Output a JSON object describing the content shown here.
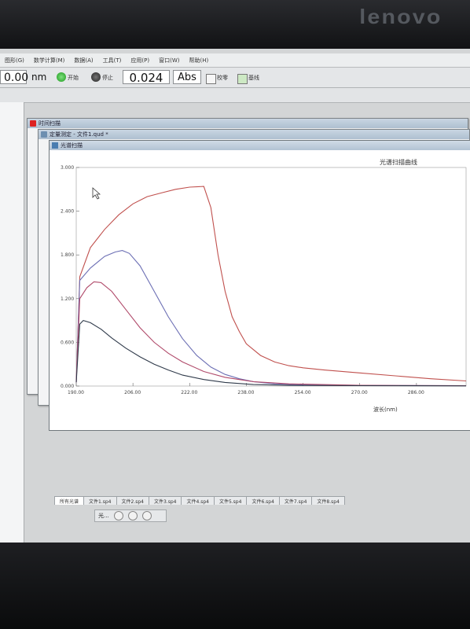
{
  "device": {
    "brand": "lenovo"
  },
  "menu": [
    "图形(G)",
    "数学计算(M)",
    "数据(A)",
    "工具(T)",
    "应用(P)",
    "窗口(W)",
    "帮助(H)"
  ],
  "toolbar": {
    "wavelength_value": "0.00",
    "wavelength_unit": "nm",
    "start_label": "开始",
    "stop_label": "停止",
    "reading_value": "0.024",
    "reading_unit": "Abs",
    "calibrate_label": "校零",
    "baseline_label": "基线"
  },
  "windows": {
    "back1_title": "时间扫描",
    "back2_title": "定量测定 - 文件1.qud *",
    "front_title": "光谱扫描"
  },
  "chart_data": {
    "type": "line",
    "title": "光谱扫描曲线",
    "xlabel": "波长(nm)",
    "ylabel": "",
    "xlim": [
      190,
      300
    ],
    "ylim": [
      0,
      3.0
    ],
    "x_ticks": [
      "190.00",
      "206.00",
      "222.00",
      "238.00",
      "254.00",
      "270.00",
      "286.00"
    ],
    "y_ticks": [
      "0.000",
      "0.600",
      "1.200",
      "1.800",
      "2.400",
      "3.000"
    ],
    "series": [
      {
        "color": "#c0504d",
        "x": [
          190,
          191,
          194,
          198,
          202,
          206,
          210,
          214,
          218,
          222,
          226,
          228,
          230,
          232,
          234,
          236,
          238,
          242,
          246,
          250,
          254,
          260,
          270,
          280,
          290,
          300
        ],
        "y": [
          0.05,
          1.5,
          1.9,
          2.15,
          2.35,
          2.5,
          2.6,
          2.65,
          2.7,
          2.73,
          2.74,
          2.45,
          1.8,
          1.3,
          0.95,
          0.75,
          0.58,
          0.42,
          0.33,
          0.28,
          0.25,
          0.22,
          0.18,
          0.14,
          0.1,
          0.07
        ]
      },
      {
        "color": "#6c6fb4",
        "x": [
          190,
          191,
          194,
          198,
          201,
          203,
          205,
          208,
          212,
          216,
          220,
          224,
          228,
          232,
          236,
          240,
          246,
          254,
          270,
          300
        ],
        "y": [
          0.05,
          1.45,
          1.62,
          1.78,
          1.84,
          1.86,
          1.82,
          1.65,
          1.3,
          0.95,
          0.65,
          0.42,
          0.26,
          0.16,
          0.1,
          0.06,
          0.03,
          0.015,
          0.01,
          0.005
        ]
      },
      {
        "color": "#b04a6a",
        "x": [
          190,
          191,
          193,
          195,
          197,
          200,
          204,
          208,
          212,
          216,
          220,
          226,
          232,
          240,
          250,
          270,
          300
        ],
        "y": [
          0.05,
          1.2,
          1.35,
          1.43,
          1.42,
          1.3,
          1.05,
          0.8,
          0.6,
          0.45,
          0.33,
          0.2,
          0.12,
          0.06,
          0.03,
          0.01,
          0.005
        ]
      },
      {
        "color": "#2f3a4a",
        "x": [
          190,
          191,
          192,
          194,
          197,
          200,
          204,
          208,
          212,
          216,
          220,
          226,
          232,
          240,
          250,
          270,
          300
        ],
        "y": [
          0.05,
          0.85,
          0.9,
          0.87,
          0.78,
          0.66,
          0.52,
          0.4,
          0.3,
          0.22,
          0.15,
          0.09,
          0.05,
          0.02,
          0.01,
          0.005,
          0.002
        ]
      }
    ]
  },
  "tabs": [
    "所有光谱",
    "文件1.sp4",
    "文件2.sp4",
    "文件3.sp4",
    "文件4.sp4",
    "文件5.sp4",
    "文件6.sp4",
    "文件7.sp4",
    "文件8.sp4"
  ],
  "taskbar": {
    "label": "光..."
  }
}
